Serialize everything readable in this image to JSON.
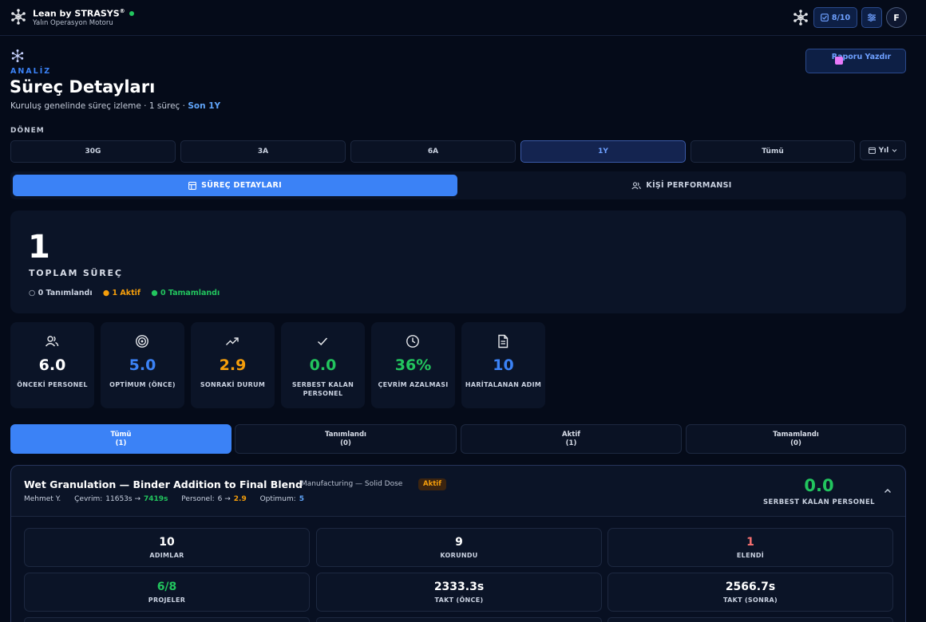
{
  "app": {
    "title": "Lean by STRASYS",
    "title_mark": "®",
    "subtitle": "Yalın Operasyon Motoru",
    "score": "8/10",
    "avatar_initial": "F"
  },
  "header": {
    "eyebrow": "ANALİZ",
    "title": "Süreç Detayları",
    "subtitle": "Kuruluş genelinde süreç izleme · 1 süreç · ",
    "subtitle_highlight": "Son 1Y",
    "print_label": "Raporu Yazdır"
  },
  "period": {
    "label": "DÖNEM",
    "options": [
      "30G",
      "3A",
      "6A",
      "1Y",
      "Tümü"
    ],
    "selected": "1Y",
    "select_value": "Yıl"
  },
  "main_tabs": [
    "SÜREÇ DETAYLARI",
    "KİŞİ PERFORMANSI"
  ],
  "summary": {
    "total": "1",
    "total_label": "TOPLAM SÜREÇ",
    "defined": "○ 0 Tanımlandı",
    "active": "● 1 Aktif",
    "completed": "● 0 Tamamlandı"
  },
  "stats": [
    {
      "icon": "users-icon",
      "value": "6.0",
      "label": "ÖNCEKİ PERSONEL",
      "color": "#ffffff"
    },
    {
      "icon": "target-icon",
      "value": "5.0",
      "label": "OPTİMUM (ÖNCE)",
      "color": "#3b82f6"
    },
    {
      "icon": "trend-up-icon",
      "value": "2.9",
      "label": "SONRAKİ DURUM",
      "color": "#f59e0b"
    },
    {
      "icon": "check-icon",
      "value": "0.0",
      "label": "SERBEST KALAN PERSONEL",
      "color": "#22c55e"
    },
    {
      "icon": "clock-icon",
      "value": "36%",
      "label": "ÇEVRİM AZALMASI",
      "color": "#22c55e"
    },
    {
      "icon": "document-icon",
      "value": "10",
      "label": "HARİTALANAN ADIM",
      "color": "#3b82f6"
    }
  ],
  "filters": [
    {
      "label": "Tümü",
      "count": "(1)"
    },
    {
      "label": "Tanımlandı",
      "count": "(0)"
    },
    {
      "label": "Aktif",
      "count": "(1)"
    },
    {
      "label": "Tamamlandı",
      "count": "(0)"
    }
  ],
  "process": {
    "title": "Wet Granulation — Binder Addition to Final Blend",
    "category": "Manufacturing — Solid Dose",
    "status": "Aktif",
    "owner": "Mehmet Y.",
    "cycle_label": "Çevrim:",
    "cycle_before": "11653s →",
    "cycle_after": "7419s",
    "staff_label": "Personel:",
    "staff_before": "6 →",
    "staff_after": "2.9",
    "optimum_label": "Optimum:",
    "optimum_value": "5",
    "freed_value": "0.0",
    "freed_label": "SERBEST KALAN PERSONEL",
    "metrics": [
      {
        "value": "10",
        "label": "ADIMLAR",
        "color": "#ffffff"
      },
      {
        "value": "9",
        "label": "KORUNDU",
        "color": "#ffffff"
      },
      {
        "value": "1",
        "label": "ELENDİ",
        "color": "#f87171"
      },
      {
        "value": "6/8",
        "label": "PROJELER",
        "color": "#22c55e"
      },
      {
        "value": "2333.3s",
        "label": "TAKT (ÖNCE)",
        "color": "#ffffff"
      },
      {
        "value": "2566.7s",
        "label": "TAKT (SONRA)",
        "color": "#ffffff"
      }
    ]
  }
}
